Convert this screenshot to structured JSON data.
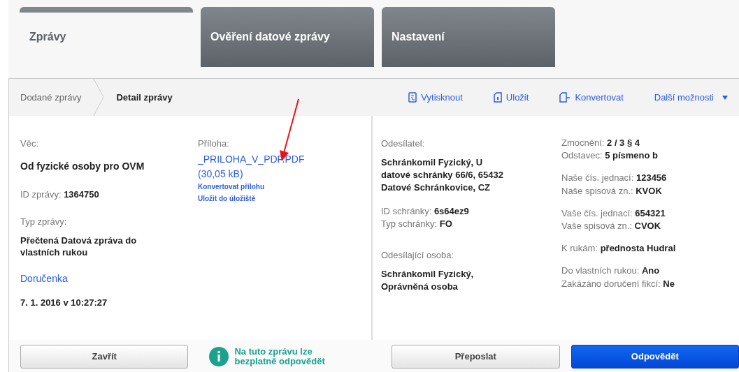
{
  "tabs": [
    {
      "label": "Zprávy",
      "selected": true
    },
    {
      "label": "Ověření datové zprávy",
      "selected": false
    },
    {
      "label": "Nastavení",
      "selected": false
    }
  ],
  "breadcrumb": [
    {
      "label": "Dodané zprávy",
      "selected": false
    },
    {
      "label": "Detail zprávy",
      "selected": true
    }
  ],
  "actions": [
    {
      "label": "Vytisknout",
      "kind": "print"
    },
    {
      "label": "Uložit",
      "kind": "save"
    },
    {
      "label": "Konvertovat",
      "kind": "convert"
    },
    {
      "label": "Další možnosti",
      "kind": "menu"
    }
  ],
  "message": {
    "subject_label": "Věc:",
    "subject": "Od fyzické osoby pro OVM",
    "id_label": "ID zprávy:",
    "id": "1364750",
    "type_label": "Typ zprávy:",
    "type": "Přečtená Datová zpráva do vlastních rukou",
    "receipt_link": "Doručenka",
    "delivered_at": "7. 1. 2016 v 10:27:27"
  },
  "attachment": {
    "label": "Příloha:",
    "file_name": "_PRILOHA_V_PDF.PDF",
    "size": "(30,05 kB)",
    "links": [
      "Konvertovat přílohu",
      "Uložit do úložiště"
    ]
  },
  "sender": {
    "label": "Odesílatel:",
    "lines": [
      "Schránkomil Fyzický, U",
      "datové schránky 66/6, 65432",
      "Datové Schránkovice, CZ"
    ],
    "box_fields": [
      {
        "label": "ID schránky:",
        "value": "6s64ez9"
      },
      {
        "label": "Typ schránky:",
        "value": "FO"
      }
    ],
    "person_label": "Odesílající osoba:",
    "person_lines": [
      "Schránkomil Fyzický,",
      "Oprávněná osoba"
    ]
  },
  "details": [
    [
      {
        "label": "Zmocnění:",
        "value": "2 / 3 § 4"
      },
      {
        "label": "Odstavec:",
        "value": "5 písmeno b"
      }
    ],
    [
      {
        "label": "Naše čís. jednací:",
        "value": "123456"
      },
      {
        "label": "Naše spisová zn.:",
        "value": "KVOK"
      }
    ],
    [
      {
        "label": "Vaše čís. jednací:",
        "value": "654321"
      },
      {
        "label": "Vaše spisová zn.:",
        "value": "CVOK"
      }
    ],
    [
      {
        "label": "K rukám:",
        "value": "přednosta Hudral"
      }
    ],
    [
      {
        "label": "Do vlastních rukou:",
        "value": "Ano"
      },
      {
        "label": "Zakázáno doručení fikcí:",
        "value": "Ne"
      }
    ]
  ],
  "footer": {
    "buttons": [
      {
        "label": "Zavřít",
        "kind": "default"
      },
      {
        "label": "Přeposlat",
        "kind": "default"
      },
      {
        "label": "Odpovědět",
        "kind": "primary"
      }
    ],
    "info": "Na tuto zprávu lze bezplatně odpovědět"
  }
}
